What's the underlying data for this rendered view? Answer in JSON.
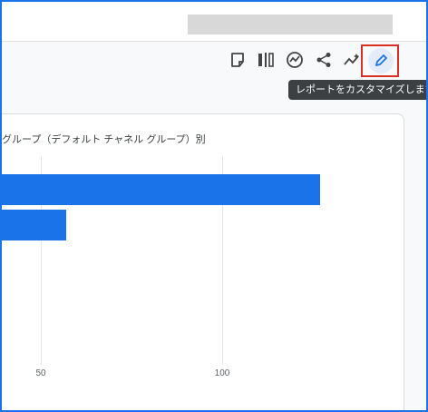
{
  "tooltip": {
    "text": "レポートをカスタマイズします"
  },
  "toolbar": {
    "icons": [
      "note-icon",
      "compare-icon",
      "insights-icon",
      "share-icon",
      "anomaly-icon",
      "pencil-icon"
    ]
  },
  "colors": {
    "accent": "#1a73e8",
    "highlight_border": "#d93025",
    "tooltip_bg": "#3c4043"
  },
  "chart_data": {
    "type": "bar",
    "orientation": "horizontal",
    "title": "グループ（デフォルト チャネル グループ）別",
    "x_ticks": [
      50,
      100
    ],
    "xlim": [
      0,
      130
    ],
    "values": [
      127,
      57
    ],
    "grid": true
  }
}
